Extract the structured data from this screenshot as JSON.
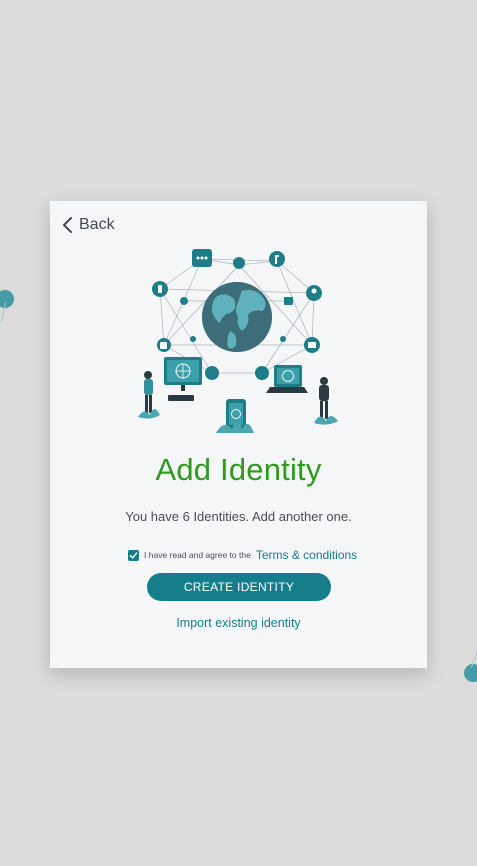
{
  "header": {
    "back_label": "Back",
    "back_icon": "chevron-left-icon"
  },
  "illustration": {
    "icon": "network-globe-illustration"
  },
  "main": {
    "title": "Add Identity",
    "subtitle": "You have 6 Identities. Add another one.",
    "terms_text": "I have read and agree to the",
    "terms_link": "Terms & conditions",
    "terms_checked": true,
    "create_button": "CREATE IDENTITY",
    "import_link": "Import existing identity"
  },
  "colors": {
    "accent": "#157e8a",
    "title": "#2e9a1e",
    "background": "#dcdcdc",
    "card": "#f5f6f8"
  }
}
